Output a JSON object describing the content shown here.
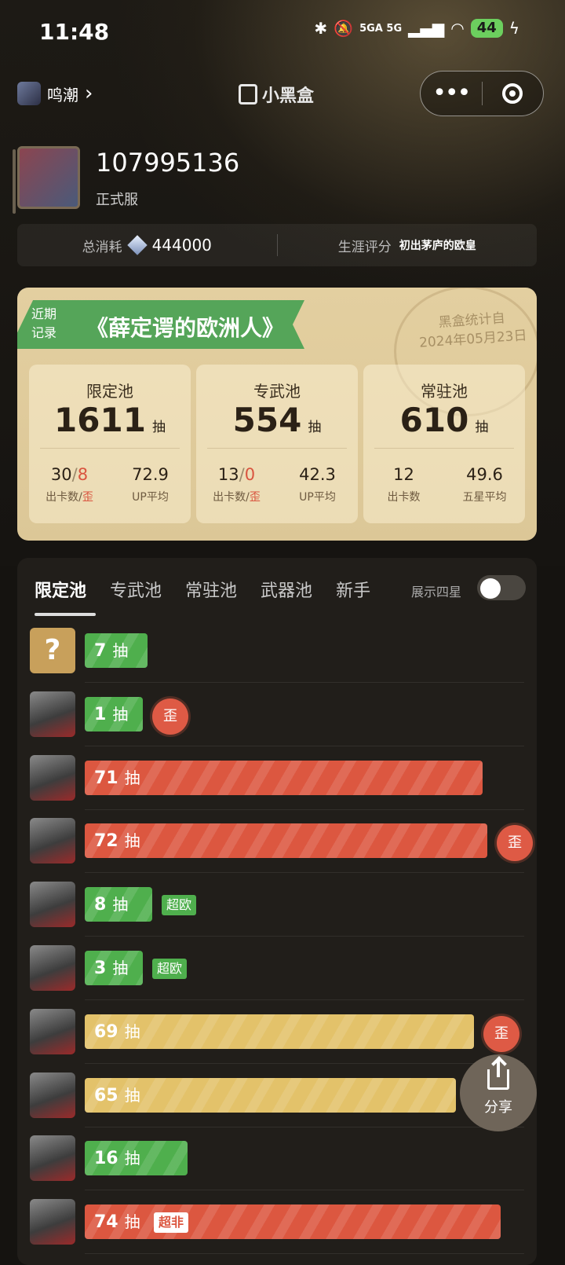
{
  "status_bar": {
    "time": "11:48",
    "signal_text": "5GA 5G",
    "battery": "44"
  },
  "nav": {
    "game_name": "鸣潮",
    "chevron": "›",
    "brand": "小黑盒",
    "more_label": "•••"
  },
  "profile": {
    "uid": "107995136",
    "server": "正式服"
  },
  "summary": {
    "total_label": "总消耗",
    "total_value": "444000",
    "career_label": "生涯评分",
    "career_value": "初出茅庐的欧皇"
  },
  "record_card": {
    "tag_line1": "近期",
    "tag_line2": "记录",
    "title": "《薛定谔的欧洲人》",
    "stamp_line1": "黑盒统计自",
    "stamp_line2": "2024年05月23日",
    "pools": [
      {
        "name": "限定池",
        "count": "1611",
        "unit": "抽",
        "s1_a": "30",
        "s1_sep": "/",
        "s1_b": "8",
        "s1_label_a": "出卡数/",
        "s1_label_b": "歪",
        "s2": "72.9",
        "s2_label": "UP平均"
      },
      {
        "name": "专武池",
        "count": "554",
        "unit": "抽",
        "s1_a": "13",
        "s1_sep": "/",
        "s1_b": "0",
        "s1_label_a": "出卡数/",
        "s1_label_b": "歪",
        "s2": "42.3",
        "s2_label": "UP平均"
      },
      {
        "name": "常驻池",
        "count": "610",
        "unit": "抽",
        "s1_a": "12",
        "s1_label_a": "出卡数",
        "s2": "49.6",
        "s2_label": "五星平均"
      }
    ]
  },
  "tabs": [
    "限定池",
    "专武池",
    "常驻池",
    "武器池",
    "新手"
  ],
  "toggle_label": "展示四星",
  "pulls": [
    {
      "count": "7",
      "unit": "抽",
      "color": "green",
      "fraction": 0.14,
      "avatar": "?"
    },
    {
      "count": "1",
      "unit": "抽",
      "color": "green",
      "fraction": 0.08,
      "badge": "歪"
    },
    {
      "count": "71",
      "unit": "抽",
      "color": "red",
      "fraction": 0.89
    },
    {
      "count": "72",
      "unit": "抽",
      "color": "red",
      "fraction": 0.9,
      "badge": "歪"
    },
    {
      "count": "8",
      "unit": "抽",
      "color": "green",
      "fraction": 0.15,
      "tag": "超欧"
    },
    {
      "count": "3",
      "unit": "抽",
      "color": "green",
      "fraction": 0.11,
      "tag": "超欧"
    },
    {
      "count": "69",
      "unit": "抽",
      "color": "yellow",
      "fraction": 0.87,
      "badge": "歪"
    },
    {
      "count": "65",
      "unit": "抽",
      "color": "yellow",
      "fraction": 0.83
    },
    {
      "count": "16",
      "unit": "抽",
      "color": "green",
      "fraction": 0.23
    },
    {
      "count": "74",
      "unit": "抽",
      "color": "red",
      "fraction": 0.93,
      "tag_white": "超非"
    }
  ],
  "share_label": "分享",
  "colors": {
    "green": "#4faf4d",
    "red": "#dc5740",
    "yellow": "#e3c26a",
    "card": "#e3cfa0"
  }
}
